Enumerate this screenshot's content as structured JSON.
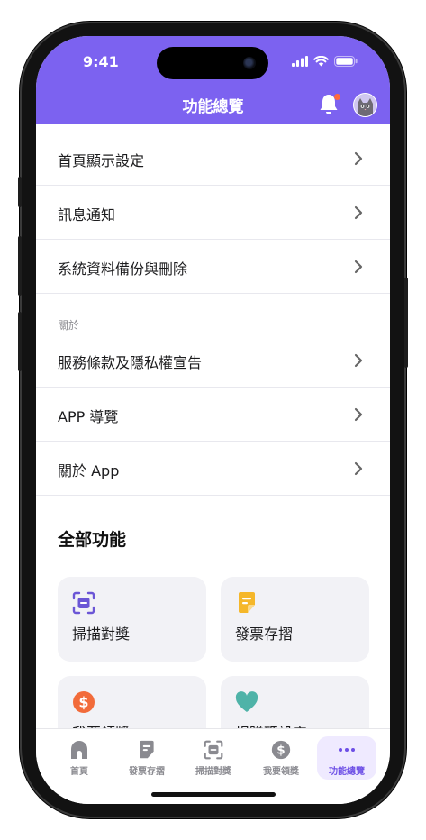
{
  "status_bar": {
    "time": "9:41"
  },
  "header": {
    "title": "功能總覽"
  },
  "settings_rows": [
    {
      "label": "首頁顯示設定"
    },
    {
      "label": "訊息通知"
    },
    {
      "label": "系統資料備份與刪除"
    }
  ],
  "about_section": {
    "heading": "關於",
    "rows": [
      {
        "label": "服務條款及隱私權宣告"
      },
      {
        "label": "APP 導覽"
      },
      {
        "label": "關於 App"
      }
    ]
  },
  "all_features": {
    "heading": "全部功能",
    "cards": [
      {
        "label": "掃描對獎",
        "icon": "scan-icon",
        "color": "#6b56d6"
      },
      {
        "label": "發票存摺",
        "icon": "receipt-icon",
        "color": "#f5b72a"
      },
      {
        "label": "我要領獎",
        "icon": "dollar-icon",
        "color": "#f26b3a"
      },
      {
        "label": "捐贈碼設定",
        "icon": "heart-icon",
        "color": "#4fb3a8"
      }
    ]
  },
  "tabbar": {
    "tabs": [
      {
        "label": "首頁",
        "icon": "home-icon"
      },
      {
        "label": "發票存摺",
        "icon": "receipt-icon"
      },
      {
        "label": "掃描對獎",
        "icon": "scan-icon"
      },
      {
        "label": "我要領獎",
        "icon": "dollar-icon"
      },
      {
        "label": "功能總覽",
        "icon": "more-icon",
        "active": true
      }
    ]
  },
  "colors": {
    "accent": "#7c62f0",
    "active_tab": "#6d4fe6",
    "notification": "#ff6a3d"
  }
}
